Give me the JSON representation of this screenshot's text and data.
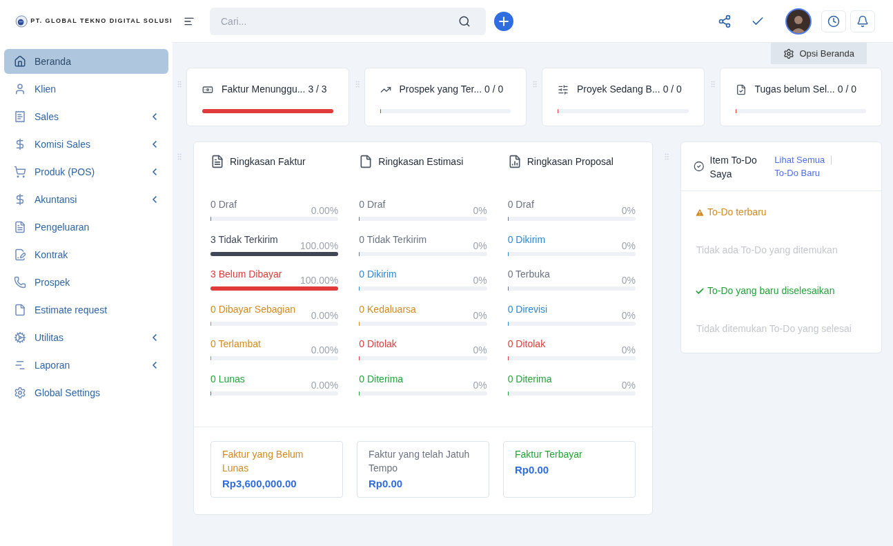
{
  "brand": {
    "name": "PT. GLOBAL TEKNO DIGITAL SOLUSI"
  },
  "search": {
    "placeholder": "Cari..."
  },
  "sidebar": {
    "items": [
      {
        "label": "Beranda",
        "selected": true,
        "has_submenu": false
      },
      {
        "label": "Klien",
        "selected": false,
        "has_submenu": false
      },
      {
        "label": "Sales",
        "selected": false,
        "has_submenu": true
      },
      {
        "label": "Komisi Sales",
        "selected": false,
        "has_submenu": true
      },
      {
        "label": "Produk (POS)",
        "selected": false,
        "has_submenu": true
      },
      {
        "label": "Akuntansi",
        "selected": false,
        "has_submenu": true
      },
      {
        "label": "Pengeluaran",
        "selected": false,
        "has_submenu": false
      },
      {
        "label": "Kontrak",
        "selected": false,
        "has_submenu": false
      },
      {
        "label": "Prospek",
        "selected": false,
        "has_submenu": false
      },
      {
        "label": "Estimate request",
        "selected": false,
        "has_submenu": false
      },
      {
        "label": "Utilitas",
        "selected": false,
        "has_submenu": true
      },
      {
        "label": "Laporan",
        "selected": false,
        "has_submenu": true
      },
      {
        "label": "Global Settings",
        "selected": false,
        "has_submenu": false
      }
    ]
  },
  "options_button": "Opsi Beranda",
  "top_cards": [
    {
      "title": "Faktur Menunggu...",
      "count": "3 / 3",
      "level": 1
    },
    {
      "title": "Prospek yang Ter...",
      "count": "0 / 0",
      "level": 0
    },
    {
      "title": "Proyek Sedang B...",
      "count": "0 / 0",
      "level": 0
    },
    {
      "title": "Tugas belum Sel...",
      "count": "0 / 0",
      "level": 0
    }
  ],
  "summaries": [
    {
      "title": "Ringkasan Faktur",
      "rows": [
        {
          "label": "0 Draf",
          "percent": "0.00%",
          "level": 0,
          "color": "#6b7280"
        },
        {
          "label": "3 Tidak Terkirim",
          "percent": "100.00%",
          "level": 1,
          "color": "#3f4756"
        },
        {
          "label": "3 Belum Dibayar",
          "percent": "100.00%",
          "level": 1,
          "color": "#e03a3a"
        },
        {
          "label": "0 Dibayar Sebagian",
          "percent": "0.00%",
          "level": 0,
          "color": "#d48a1f"
        },
        {
          "label": "0 Terlambat",
          "percent": "0.00%",
          "level": 0,
          "color": "#d48a1f"
        },
        {
          "label": "0 Lunas",
          "percent": "0.00%",
          "level": 0,
          "color": "#22a33a"
        }
      ]
    },
    {
      "title": "Ringkasan Estimasi",
      "rows": [
        {
          "label": "0 Draf",
          "percent": "0%",
          "level": 0,
          "color": "#6b7280"
        },
        {
          "label": "0 Tidak Terkirim",
          "percent": "0%",
          "level": 0,
          "color": "#6b7280"
        },
        {
          "label": "0 Dikirim",
          "percent": "0%",
          "level": 0,
          "color": "#2d87d3"
        },
        {
          "label": "0 Kedaluarsa",
          "percent": "0%",
          "level": 0,
          "color": "#d48a1f"
        },
        {
          "label": "0 Ditolak",
          "percent": "0%",
          "level": 0,
          "color": "#e03a3a"
        },
        {
          "label": "0 Diterima",
          "percent": "0%",
          "level": 0,
          "color": "#22a33a"
        }
      ]
    },
    {
      "title": "Ringkasan Proposal",
      "rows": [
        {
          "label": "0 Draf",
          "percent": "0%",
          "level": 0,
          "color": "#6b7280"
        },
        {
          "label": "0 Dikirim",
          "percent": "0%",
          "level": 0,
          "color": "#2d87d3"
        },
        {
          "label": "0 Terbuka",
          "percent": "0%",
          "level": 0,
          "color": "#6b7280"
        },
        {
          "label": "0 Direvisi",
          "percent": "0%",
          "level": 0,
          "color": "#2d87d3"
        },
        {
          "label": "0 Ditolak",
          "percent": "0%",
          "level": 0,
          "color": "#e03a3a"
        },
        {
          "label": "0 Diterima",
          "percent": "0%",
          "level": 0,
          "color": "#22a33a"
        }
      ]
    }
  ],
  "totals": [
    {
      "title": "Faktur yang Belum Lunas",
      "amount": "Rp3,600,000.00",
      "color": "#d48a1f"
    },
    {
      "title": "Faktur yang telah Jatuh Tempo",
      "amount": "Rp0.00",
      "color": "#6b7280"
    },
    {
      "title": "Faktur Terbayar",
      "amount": "Rp0.00",
      "color": "#22a33a"
    }
  ],
  "todo": {
    "title": "Item To-Do Saya",
    "links": [
      "Lihat Semua",
      "To-Do Baru"
    ],
    "sections": [
      {
        "kind": "warning",
        "heading": "To-Do terbaru",
        "empty_text": "Tidak ada To-Do yang ditemukan"
      },
      {
        "kind": "done",
        "heading": "To-Do yang baru diselesaikan",
        "empty_text": "Tidak ditemukan To-Do yang selesai"
      }
    ]
  }
}
